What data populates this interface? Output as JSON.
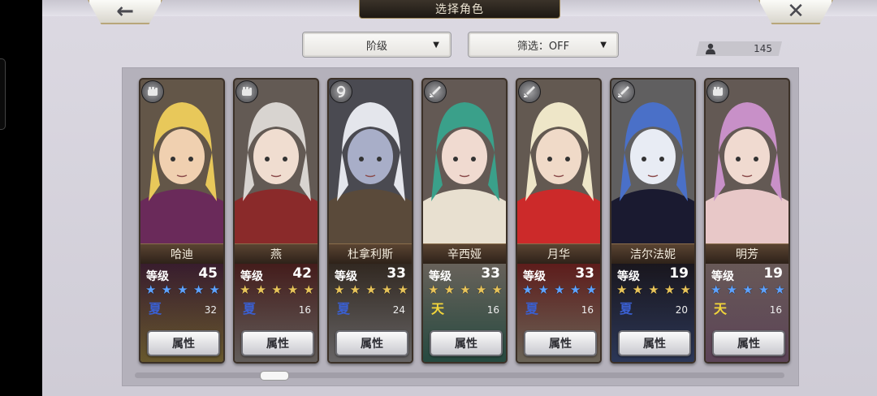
{
  "header": {
    "title": "选择角色",
    "back_icon": "back-arrow-icon",
    "close_icon": "close-x-icon"
  },
  "toolbar": {
    "sort_label": "阶级",
    "filter_label": "筛选：OFF",
    "roster_count": "145"
  },
  "colors": {
    "blue_star": "#5ea2ff",
    "gold_star": "#e8c45a",
    "elem_blue": "#3a5fd0",
    "elem_gold": "#f2d53a"
  },
  "characters": [
    {
      "name": "哈迪",
      "level_label": "等级",
      "level": "45",
      "stars": "★★★★★",
      "star_color": "blue",
      "element": "夏",
      "count": "32",
      "button": "属性",
      "badge": "fist-icon",
      "palette": [
        "#e8c85a",
        "#f0d0b0",
        "#6a2a5a"
      ]
    },
    {
      "name": "燕",
      "level_label": "等级",
      "level": "42",
      "stars": "★★★★★",
      "star_color": "gold",
      "element": "夏",
      "count": "16",
      "button": "属性",
      "badge": "fist-icon",
      "palette": [
        "#d8d4d0",
        "#f0ddd0",
        "#8a2a2a"
      ]
    },
    {
      "name": "杜拿利斯",
      "level_label": "等级",
      "level": "33",
      "stars": "★★★★★",
      "star_color": "gold",
      "element": "夏",
      "count": "24",
      "button": "属性",
      "badge": "nine-icon",
      "palette": [
        "#e4e6ec",
        "#a8aec8",
        "#5a4a3a"
      ]
    },
    {
      "name": "辛西娅",
      "level_label": "等级",
      "level": "33",
      "stars": "★★★★★",
      "star_color": "gold",
      "element": "天",
      "count": "16",
      "button": "属性",
      "badge": "sword-icon",
      "palette": [
        "#3aa08a",
        "#f0dad0",
        "#e8e0d0"
      ]
    },
    {
      "name": "月华",
      "level_label": "等级",
      "level": "33",
      "stars": "★★★★★",
      "star_color": "blue",
      "element": "夏",
      "count": "16",
      "button": "属性",
      "badge": "sword-icon",
      "palette": [
        "#eee6c8",
        "#f0dac8",
        "#cc2a2a"
      ]
    },
    {
      "name": "洁尔法妮",
      "level_label": "等级",
      "level": "19",
      "stars": "★★★★★",
      "star_color": "gold",
      "element": "夏",
      "count": "20",
      "button": "属性",
      "badge": "sword-icon",
      "palette": [
        "#4a70c8",
        "#e8ecf4",
        "#1a1a30"
      ]
    },
    {
      "name": "明芳",
      "level_label": "等级",
      "level": "19",
      "stars": "★★★★★",
      "star_color": "blue",
      "element": "天",
      "count": "16",
      "button": "属性",
      "badge": "fist-icon",
      "palette": [
        "#c890c8",
        "#f0dad0",
        "#e8c8c8"
      ]
    }
  ]
}
